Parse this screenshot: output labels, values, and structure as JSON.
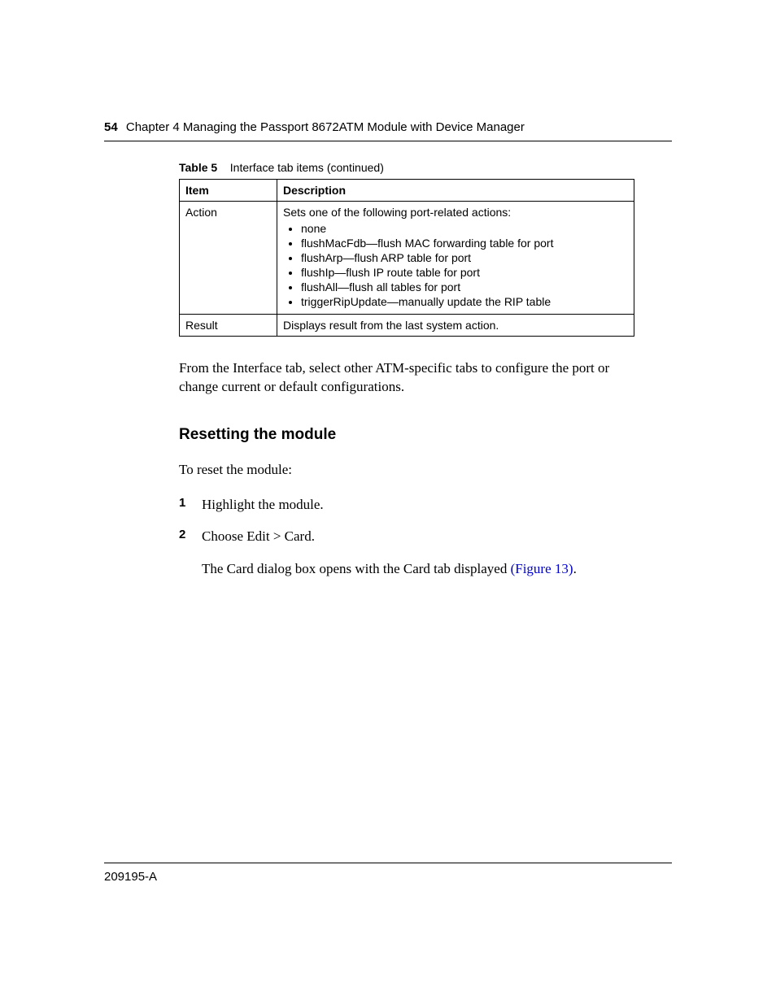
{
  "header": {
    "page_number": "54",
    "chapter_label": "Chapter 4  Managing the Passport 8672ATM Module with Device Manager"
  },
  "table_caption": {
    "label": "Table 5",
    "text": "Interface tab items (continued)"
  },
  "table": {
    "headers": {
      "item": "Item",
      "description": "Description"
    },
    "rows": [
      {
        "item": "Action",
        "desc_intro": "Sets one of the following port-related actions:",
        "bullets": [
          "none",
          "flushMacFdb—flush MAC forwarding table for port",
          "flushArp—flush ARP table for port",
          "flushIp—flush IP route table for port",
          "flushAll—flush all tables for port",
          "triggerRipUpdate—manually update the RIP table"
        ]
      },
      {
        "item": "Result",
        "desc_intro": "Displays result from the last system action."
      }
    ]
  },
  "body_paragraph": "From the Interface tab, select other ATM-specific tabs to configure the port or change current or default configurations.",
  "section_heading": "Resetting the module",
  "intro_text": "To reset the module:",
  "steps": [
    {
      "text": "Highlight the module."
    },
    {
      "text": "Choose Edit > Card.",
      "followup_prefix": "The Card dialog box opens with the Card tab displayed ",
      "followup_link": "(Figure 13)",
      "followup_suffix": "."
    }
  ],
  "footer": {
    "doc_id": "209195-A"
  }
}
